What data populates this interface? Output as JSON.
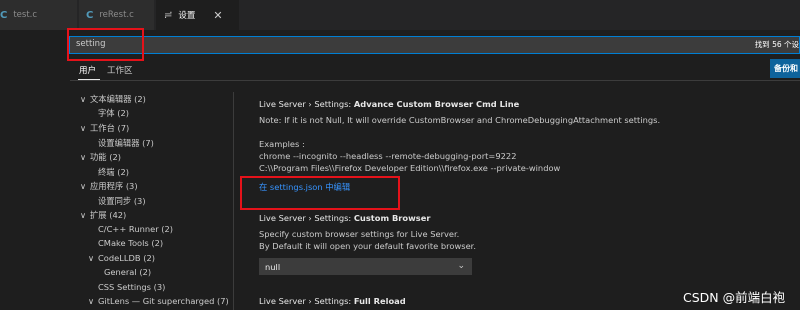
{
  "tabs": [
    {
      "icon": "C",
      "label": "test.c"
    },
    {
      "icon": "C",
      "label": "reRest.c"
    },
    {
      "icon": "≓",
      "label": "设置",
      "close": "✕"
    }
  ],
  "search": {
    "value": "setting",
    "result_count": "找到 56 个设"
  },
  "scope_tabs": {
    "user": "用户",
    "workspace": "工作区"
  },
  "backup_button": "备份和",
  "toc": [
    {
      "chev": "∨",
      "label": "文本编辑器 (2)"
    },
    {
      "chev": "",
      "label": "字体 (2)"
    },
    {
      "chev": "∨",
      "label": "工作台 (7)"
    },
    {
      "chev": "",
      "label": "设置编辑器 (7)"
    },
    {
      "chev": "∨",
      "label": "功能 (2)"
    },
    {
      "chev": "",
      "label": "终端 (2)"
    },
    {
      "chev": "∨",
      "label": "应用程序 (3)"
    },
    {
      "chev": "",
      "label": "设置同步 (3)"
    },
    {
      "chev": "∨",
      "label": "扩展 (42)"
    },
    {
      "chev": "",
      "label": "C/C++ Runner (2)"
    },
    {
      "chev": "",
      "label": "CMake Tools (2)"
    },
    {
      "chev": "∨",
      "label": "CodeLLDB (2)"
    },
    {
      "chev": "",
      "label": "General (2)"
    },
    {
      "chev": "",
      "label": "CSS Settings (3)"
    },
    {
      "chev": "∨",
      "label": "GitLens — Git supercharged (7)"
    }
  ],
  "settings": {
    "s1_prefix": "Live Server › Settings: ",
    "s1_name": "Advance Custom Browser Cmd Line",
    "s1_note": "Note: If it is not Null, It will override CustomBrowser and ChromeDebuggingAttachment settings.",
    "s1_examples": "Examples :",
    "s1_ex1": "chrome --incognito --headless --remote-debugging-port=9222",
    "s1_ex2": "C:\\\\Program Files\\\\Firefox Developer Edition\\\\firefox.exe --private-window",
    "s1_link": "在 settings.json 中编辑",
    "s2_prefix": "Live Server › Settings: ",
    "s2_name": "Custom Browser",
    "s2_desc1": "Specify custom browser settings for Live Server.",
    "s2_desc2": "By Default it will open your default favorite browser.",
    "s2_value": "null",
    "s3_prefix": "Live Server › Settings: ",
    "s3_name": "Full Reload"
  },
  "watermark": "CSDN @前端白袍"
}
